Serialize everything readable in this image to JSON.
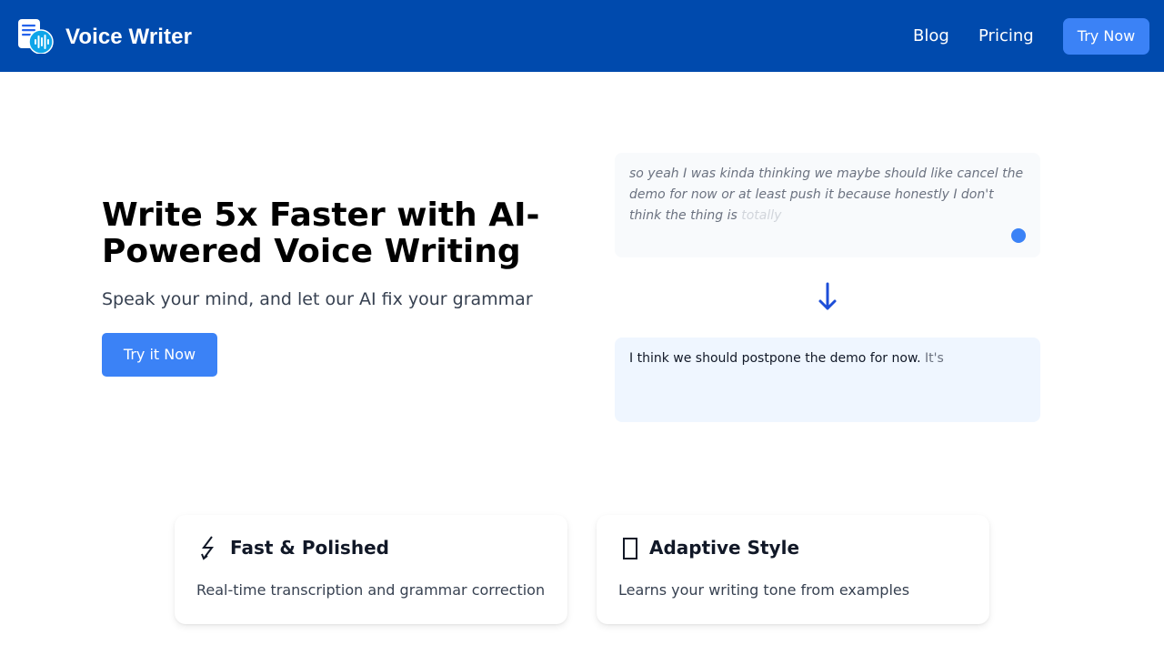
{
  "header": {
    "brand": "Voice Writer",
    "logo_icon": "document-soundwave-icon",
    "nav": {
      "blog_label": "Blog",
      "pricing_label": "Pricing",
      "cta_label": "Try Now"
    }
  },
  "hero": {
    "title": "Write 5x Faster with AI-Powered Voice Writing",
    "subtitle": "Speak your mind, and let our AI fix your grammar",
    "cta_label": "Try it Now"
  },
  "demo": {
    "raw_text": "so yeah I was kinda thinking we maybe should like cancel the demo for now or at least push it because honestly I don't think the thing is",
    "raw_text_fading": "totally",
    "arrow_icon": "arrow-down-icon",
    "polished_text": "I think we should postpone the demo for now.",
    "polished_pending": "It's"
  },
  "features": [
    {
      "icon": "lightning-icon",
      "title": "Fast & Polished",
      "description": "Real-time transcription and grammar correction"
    },
    {
      "icon": "missing-glyph-icon",
      "title": "Adaptive Style",
      "description": "Learns your writing tone from examples"
    }
  ],
  "colors": {
    "nav_background": "#004aad",
    "accent": "#3b82f6",
    "arrow": "#1d4ed8",
    "raw_box": "#f8fafc",
    "polished_box": "#eff6ff"
  }
}
